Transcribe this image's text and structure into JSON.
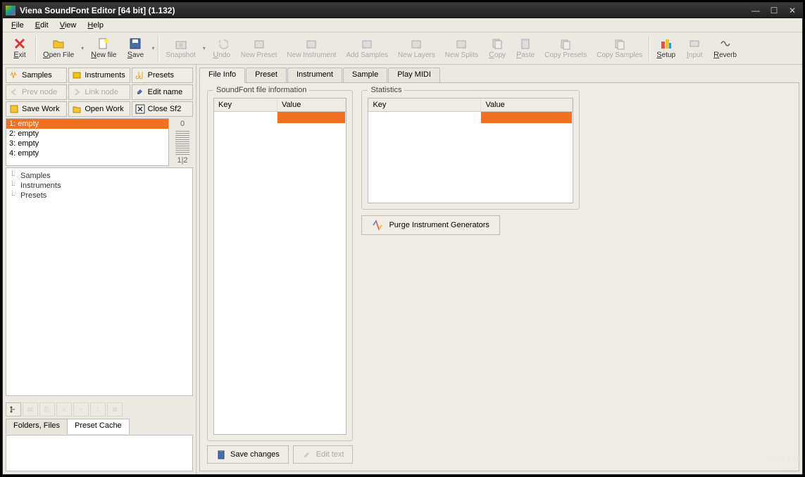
{
  "title": "Viena SoundFont Editor [64 bit] (1.132)",
  "menu": {
    "file": "File",
    "edit": "Edit",
    "view": "View",
    "help": "Help"
  },
  "toolbar": {
    "exit": "Exit",
    "open": "Open File",
    "newfile": "New file",
    "save": "Save",
    "snapshot": "Snapshot",
    "undo": "Undo",
    "newpreset": "New Preset",
    "newinstr": "New Instrument",
    "addsamples": "Add Samples",
    "newlayers": "New Layers",
    "newsplits": "New Splits",
    "copy": "Copy",
    "paste": "Paste",
    "copypresets": "Copy Presets",
    "copysamples": "Copy Samples",
    "setup": "Setup",
    "input": "Input",
    "reverb": "Reverb"
  },
  "leftButtons": {
    "samples": "Samples",
    "instruments": "Instruments",
    "presets": "Presets",
    "prevnode": "Prev node",
    "linknode": "Link node",
    "editname": "Edit name",
    "savework": "Save Work",
    "openwork": "Open Work",
    "closesf2": "Close Sf2"
  },
  "numlist": [
    "1: empty",
    "2: empty",
    "3: empty",
    "4: empty"
  ],
  "scale": {
    "top": "0",
    "bottom": "1|2"
  },
  "tree": [
    "Samples",
    "Instruments",
    "Presets"
  ],
  "bottomTabs": {
    "folders": "Folders, Files",
    "cache": "Preset Cache"
  },
  "rightTabs": {
    "fileinfo": "File Info",
    "preset": "Preset",
    "instrument": "Instrument",
    "sample": "Sample",
    "playmidi": "Play MIDI"
  },
  "fieldset1": {
    "legend": "SoundFont file information",
    "col1": "Key",
    "col2": "Value"
  },
  "fieldset2": {
    "legend": "Statistics",
    "col1": "Key",
    "col2": "Value"
  },
  "actions": {
    "savechanges": "Save changes",
    "edittext": "Edit text",
    "purge": "Purge Instrument Generators"
  },
  "watermark": "9553下载"
}
